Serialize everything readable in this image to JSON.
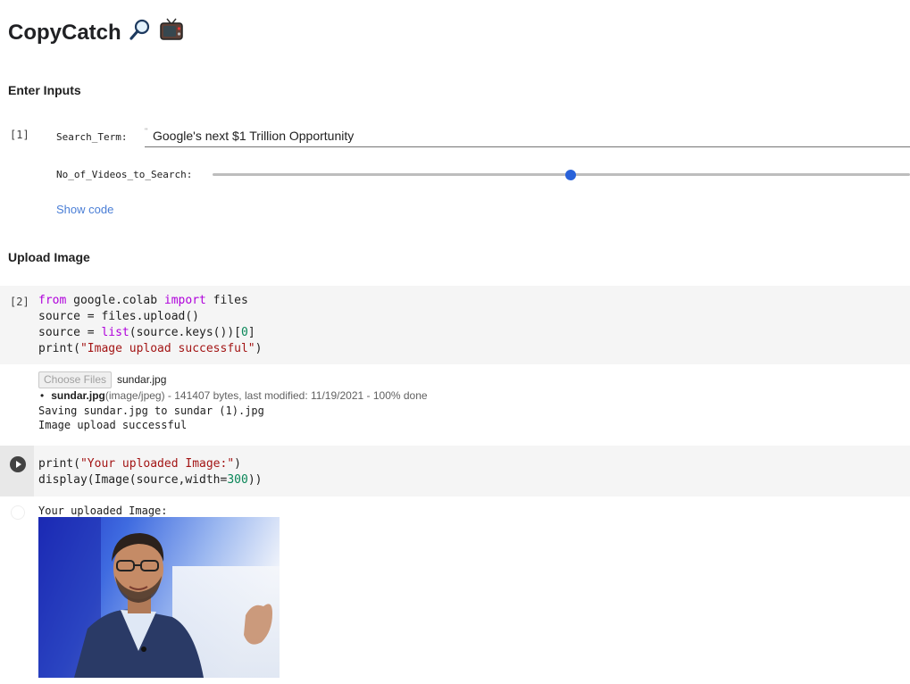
{
  "notebook": {
    "title": "CopyCatch",
    "title_icons": [
      "magnifier-icon",
      "television-icon"
    ]
  },
  "sections": {
    "inputs_heading": "Enter Inputs",
    "upload_heading": "Upload Image"
  },
  "form_cell": {
    "exec_count": "[1]",
    "search_label": "Search_Term:",
    "search_quote_mark": "\"",
    "search_value": "Google's next $1 Trillion Opportunity",
    "videos_label": "No_of_Videos_to_Search:",
    "show_code": "Show code"
  },
  "upload_cell": {
    "exec_count": "[2]",
    "code_lines": [
      "from google.colab import files",
      "source = files.upload()",
      "source = list(source.keys())[0]",
      "print(\"Image upload successful\")"
    ],
    "output": {
      "choose_files_label": "Choose Files",
      "chosen_file": "sundar.jpg",
      "status_filename": "sundar.jpg",
      "status_detail": "(image/jpeg) - 141407 bytes, last modified: 11/19/2021 - 100% done",
      "saving_line": "Saving sundar.jpg to sundar (1).jpg",
      "success_line": "Image upload successful"
    }
  },
  "display_cell": {
    "code_lines": [
      "print(\"Your uploaded Image:\")",
      "display(Image(source,width=300))"
    ],
    "output": {
      "caption": "Your uploaded Image:",
      "image_icon": "portrait-photo"
    }
  },
  "colors": {
    "accent_link": "#4a7ed6",
    "slider_thumb": "#2962d9",
    "keyword": "#af00db",
    "string": "#a31515",
    "number": "#098658"
  }
}
